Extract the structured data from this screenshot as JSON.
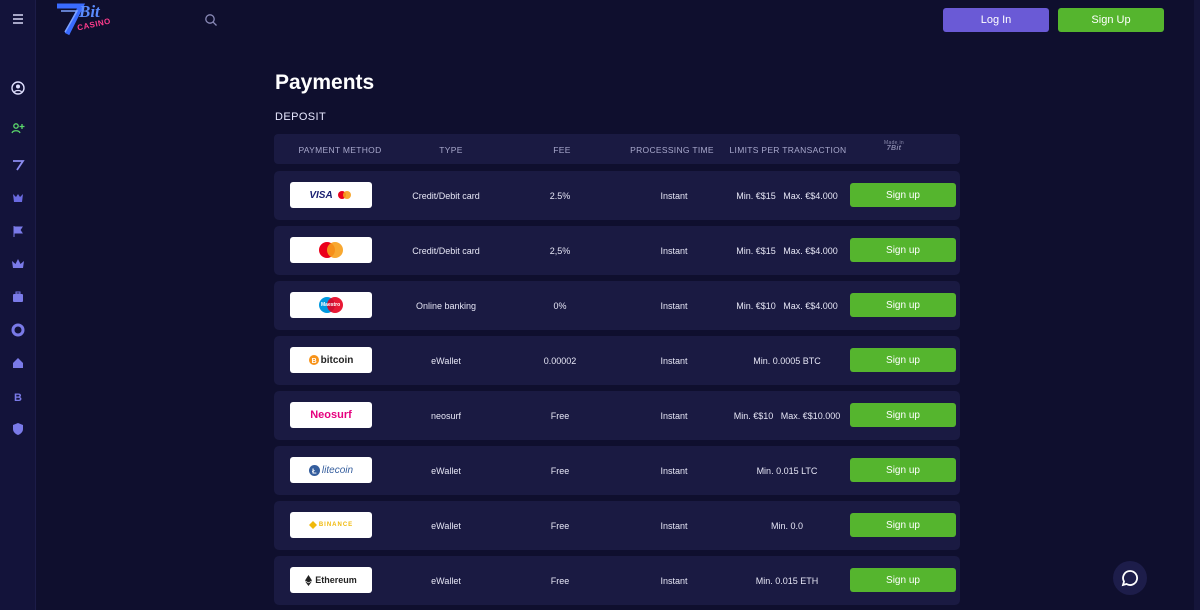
{
  "header": {
    "logo_text": "Bit",
    "logo_sub": "CASINO",
    "login_label": "Log In",
    "signup_label": "Sign Up"
  },
  "page": {
    "title": "Payments",
    "section": "DEPOSIT"
  },
  "table": {
    "headers": [
      "PAYMENT METHOD",
      "TYPE",
      "FEE",
      "PROCESSING TIME",
      "LIMITS PER TRANSACTION"
    ],
    "made_in_line1": "Made in",
    "made_in_line2": "7Bit",
    "rows": [
      {
        "method": "VISA",
        "type": "Credit/Debit card",
        "fee": "2.5%",
        "time": "Instant",
        "limits": "Min. €$15   Max. €$4.000",
        "button": "Sign up"
      },
      {
        "method": "Mastercard",
        "type": "Credit/Debit card",
        "fee": "2,5%",
        "time": "Instant",
        "limits": "Min. €$15   Max. €$4.000",
        "button": "Sign up"
      },
      {
        "method": "Maestro",
        "type": "Online banking",
        "fee": "0%",
        "time": "Instant",
        "limits": "Min. €$10   Max. €$4.000",
        "button": "Sign up"
      },
      {
        "method": "bitcoin",
        "type": "eWallet",
        "fee": "0.00002",
        "time": "Instant",
        "limits": "Min. 0.0005 BTC",
        "button": "Sign up"
      },
      {
        "method": "Neosurf",
        "type": "neosurf",
        "fee": "Free",
        "time": "Instant",
        "limits": "Min. €$10   Max. €$10.000",
        "button": "Sign up"
      },
      {
        "method": "litecoin",
        "type": "eWallet",
        "fee": "Free",
        "time": "Instant",
        "limits": "Min. 0.015 LTC",
        "button": "Sign up"
      },
      {
        "method": "BINANCE",
        "type": "eWallet",
        "fee": "Free",
        "time": "Instant",
        "limits": "Min. 0.0",
        "button": "Sign up"
      },
      {
        "method": "Ethereum",
        "type": "eWallet",
        "fee": "Free",
        "time": "Instant",
        "limits": "Min. 0.015 ETH",
        "button": "Sign up"
      }
    ]
  },
  "colors": {
    "background": "#0f0f2e",
    "row_bg": "#1a1a42",
    "accent_green": "#55b52e",
    "accent_purple": "#6a5ad6"
  },
  "icons": {
    "sidebar": [
      "menu-icon",
      "profile-icon",
      "add-user-icon",
      "7bit-icon",
      "tournament-icon",
      "flag-icon",
      "crown-icon",
      "briefcase-icon",
      "lifebuoy-icon",
      "home-icon",
      "bitcoin-icon",
      "shield-icon"
    ],
    "search": "search-icon",
    "chat": "chat-icon"
  }
}
